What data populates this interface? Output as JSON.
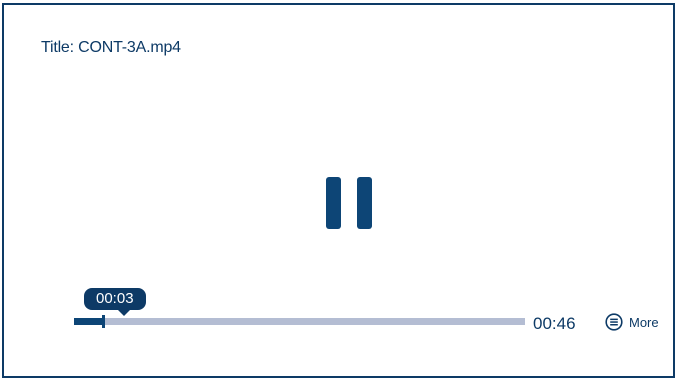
{
  "player": {
    "title_label": "Title: CONT-3A.mp4",
    "state_icon": "pause-icon",
    "current_time": "00:03",
    "duration": "00:46",
    "progress_fraction": 0.065,
    "more_label": "More",
    "more_icon": "menu-circle-icon"
  },
  "colors": {
    "accent": "#0d3a66",
    "track": "#b4bdd3",
    "background": "#ffffff"
  }
}
